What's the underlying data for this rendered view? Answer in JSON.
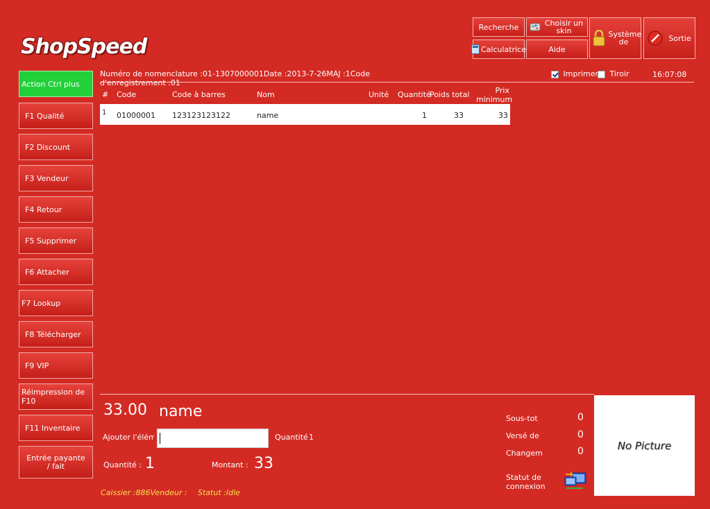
{
  "app": {
    "logo": "ShopSpeed"
  },
  "top_buttons": {
    "recherche": "Recherche",
    "choisir_skin": "Choisir un skin",
    "systeme": "Système de",
    "sortie": "Sortie",
    "calculatrice": "Calculatrice",
    "aide": "Aide"
  },
  "left_buttons": [
    "Action Ctrl plus",
    "F1 Qualité",
    "F2 Discount",
    "F3 Vendeur",
    "F4 Retour",
    "F5 Supprimer",
    "F6 Attacher",
    "F7 Lookup",
    "F8 Télécharger",
    "F9 VIP",
    "Réimpression de F10",
    "F11 Inventaire",
    "Entrée payante / fait"
  ],
  "info": {
    "line": "Numéro de nomenclature :01-1307000001Date :2013-7-26MAJ :1Code d'enregistrement :01",
    "imprimer": "Imprimer",
    "tiroir": "Tiroir",
    "time": "16:07:08"
  },
  "table": {
    "headers": {
      "num": "#",
      "code": "Code",
      "barcode": "Code à barres",
      "nom": "Nom",
      "unite": "Unité",
      "quantite": "Quantité",
      "poids": "Poids total",
      "prix": "Prix minimum"
    },
    "rows": [
      {
        "num": "1",
        "code": "01000001",
        "barcode": "123123123122",
        "nom": "name",
        "unite": "",
        "quantite": "1",
        "poids": "33",
        "prix": "33"
      }
    ]
  },
  "bottom": {
    "price": "33.00",
    "name": "name",
    "ajouter_label": "Ajouter l'élémer",
    "ajouter_value": "",
    "quantite_label_small": "Quantité",
    "quantite_value_small": "1",
    "quantite_label": "Quantité :",
    "quantite_value": "1",
    "montant_label": "Montant :",
    "montant_value": "33",
    "sous_total_label": "Sous-tota",
    "sous_total_value": "0",
    "verse_label": "Versé de",
    "verse_value": "0",
    "change_label": "Changem",
    "change_value": "0",
    "statut_label": "Statut de connexion",
    "no_picture": "No Picture",
    "caissier": "Caissier :886Vendeur :",
    "statut": "Statut :Idle"
  },
  "colors": {
    "background": "#d42a24",
    "accent_green": "#22d03a"
  }
}
